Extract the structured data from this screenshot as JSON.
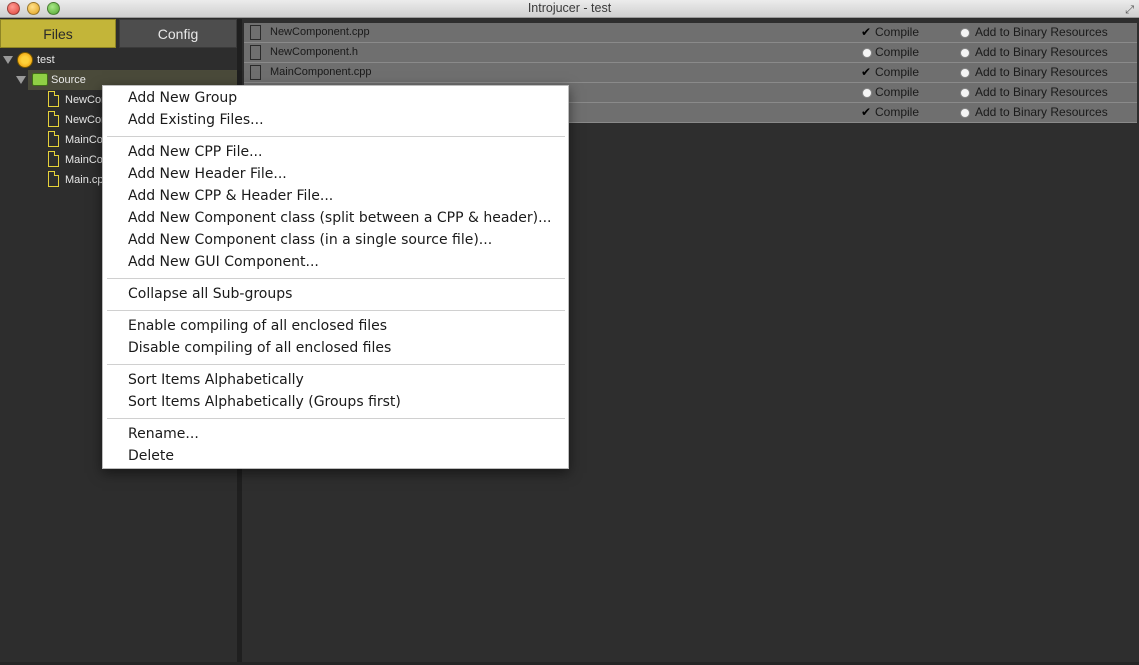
{
  "window": {
    "title": "Introjucer - test"
  },
  "tabs": {
    "files": "Files",
    "config": "Config"
  },
  "tree": {
    "project": "test",
    "group": "Source",
    "files": [
      "NewCom",
      "NewCom",
      "MainCo",
      "MainCo",
      "Main.cp"
    ]
  },
  "file_list": [
    {
      "name": "NewComponent.cpp",
      "compile": true,
      "compile_label": "Compile",
      "binary_label": "Add to Binary Resources"
    },
    {
      "name": "NewComponent.h",
      "compile": false,
      "compile_label": "Compile",
      "binary_label": "Add to Binary Resources"
    },
    {
      "name": "MainComponent.cpp",
      "compile": true,
      "compile_label": "Compile",
      "binary_label": "Add to Binary Resources"
    },
    {
      "name": "",
      "compile": false,
      "compile_label": "Compile",
      "binary_label": "Add to Binary Resources"
    },
    {
      "name": "",
      "compile": true,
      "compile_label": "Compile",
      "binary_label": "Add to Binary Resources"
    }
  ],
  "context_menu": {
    "groups": [
      [
        "Add New Group",
        "Add Existing Files..."
      ],
      [
        "Add New CPP File...",
        "Add New Header File...",
        "Add New CPP & Header File...",
        "Add New Component class (split between a CPP & header)...",
        "Add New Component class (in a single source file)...",
        "Add New GUI Component..."
      ],
      [
        "Collapse all Sub-groups"
      ],
      [
        "Enable compiling of all enclosed files",
        "Disable compiling of all enclosed files"
      ],
      [
        "Sort Items Alphabetically",
        "Sort Items Alphabetically (Groups first)"
      ],
      [
        "Rename...",
        "Delete"
      ]
    ]
  },
  "colors": {
    "files_tab": "#c3b539",
    "config_tab": "#4d4d4d",
    "file_row": "#6f6f6f",
    "file_icon": "#e6d23a"
  }
}
